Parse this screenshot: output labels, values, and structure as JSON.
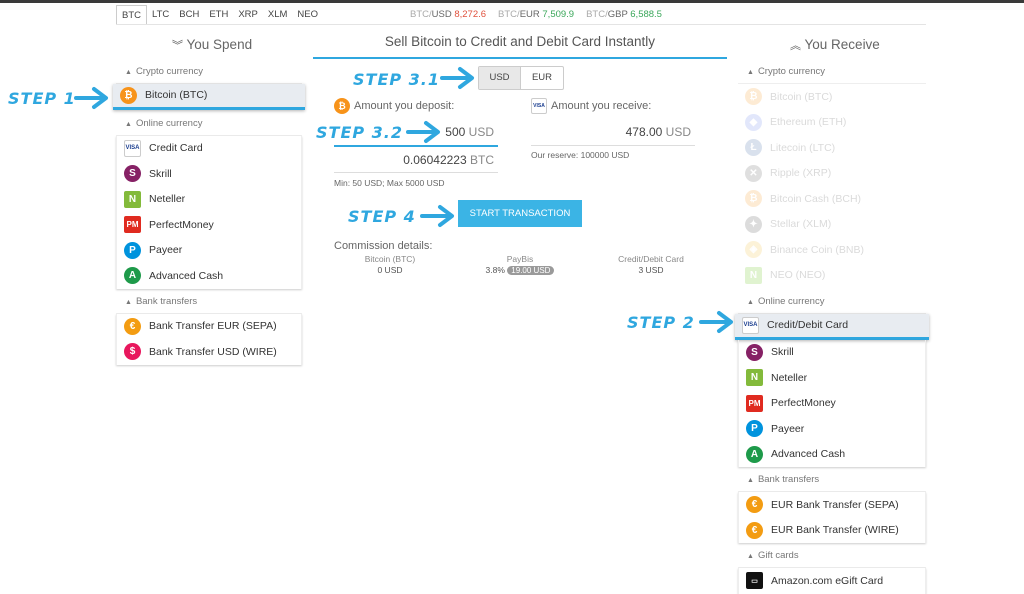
{
  "coins": [
    "BTC",
    "LTC",
    "BCH",
    "ETH",
    "XRP",
    "XLM",
    "NEO"
  ],
  "rates": [
    {
      "base": "BTC",
      "quote": "USD",
      "value": "8,272.6",
      "trend": "down"
    },
    {
      "base": "BTC",
      "quote": "EUR",
      "value": "7,509.9",
      "trend": "up"
    },
    {
      "base": "BTC",
      "quote": "GBP",
      "value": "6,588.5",
      "trend": "up"
    }
  ],
  "spend": {
    "title": "You Spend",
    "crypto_head": "Crypto currency",
    "crypto": [
      {
        "label": "Bitcoin (BTC)",
        "icon": "bitcoin-icon"
      }
    ],
    "online_head": "Online currency",
    "online": [
      {
        "label": "Credit Card",
        "icon": "credit-card-icon"
      },
      {
        "label": "Skrill",
        "icon": "skrill-icon"
      },
      {
        "label": "Neteller",
        "icon": "neteller-icon"
      },
      {
        "label": "PerfectMoney",
        "icon": "perfectmoney-icon"
      },
      {
        "label": "Payeer",
        "icon": "payeer-icon"
      },
      {
        "label": "Advanced Cash",
        "icon": "advanced-cash-icon"
      }
    ],
    "bank_head": "Bank transfers",
    "bank": [
      {
        "label": "Bank Transfer EUR (SEPA)",
        "icon": "euro-icon"
      },
      {
        "label": "Bank Transfer USD (WIRE)",
        "icon": "dollar-icon"
      }
    ]
  },
  "receive": {
    "title": "You Receive",
    "crypto_head": "Crypto currency",
    "crypto": [
      {
        "label": "Bitcoin (BTC)"
      },
      {
        "label": "Ethereum (ETH)"
      },
      {
        "label": "Litecoin (LTC)"
      },
      {
        "label": "Ripple (XRP)"
      },
      {
        "label": "Bitcoin Cash (BCH)"
      },
      {
        "label": "Stellar (XLM)"
      },
      {
        "label": "Binance Coin (BNB)"
      },
      {
        "label": "NEO (NEO)"
      }
    ],
    "online_head": "Online currency",
    "online": [
      {
        "label": "Credit/Debit Card"
      },
      {
        "label": "Skrill"
      },
      {
        "label": "Neteller"
      },
      {
        "label": "PerfectMoney"
      },
      {
        "label": "Payeer"
      },
      {
        "label": "Advanced Cash"
      }
    ],
    "bank_head": "Bank transfers",
    "bank": [
      {
        "label": "EUR Bank Transfer (SEPA)"
      },
      {
        "label": "EUR Bank Transfer (WIRE)"
      }
    ],
    "gift_head": "Gift cards",
    "gift": [
      {
        "label": "Amazon.com eGift Card"
      }
    ]
  },
  "center": {
    "title": "Sell Bitcoin to Credit and Debit Card Instantly",
    "toggle": [
      "USD",
      "EUR"
    ],
    "deposit_label": "Amount you deposit:",
    "receive_label": "Amount you receive:",
    "deposit_value": "500",
    "deposit_unit": "USD",
    "btc_value": "0.06042223",
    "btc_unit": "BTC",
    "receive_value": "478.00",
    "receive_unit": "USD",
    "limits": "Min: 50 USD; Max 5000 USD",
    "reserve": "Our reserve: 100000 USD",
    "button": "START TRANSACTION",
    "commission_title": "Commission details:",
    "comm": [
      {
        "head": "Bitcoin (BTC)",
        "value": "0 USD"
      },
      {
        "head": "PayBis",
        "value": "3.8%",
        "pill": "19.00 USD"
      },
      {
        "head": "Credit/Debit Card",
        "value": "3 USD"
      }
    ]
  },
  "steps": {
    "s1": "STEP 1",
    "s2": "STEP 2",
    "s31": "STEP 3.1",
    "s32": "STEP 3.2",
    "s4": "STEP 4"
  },
  "colors": {
    "accent": "#2fa7df",
    "button": "#3bb4e5",
    "down": "#e0523e",
    "up": "#3aa75a"
  }
}
